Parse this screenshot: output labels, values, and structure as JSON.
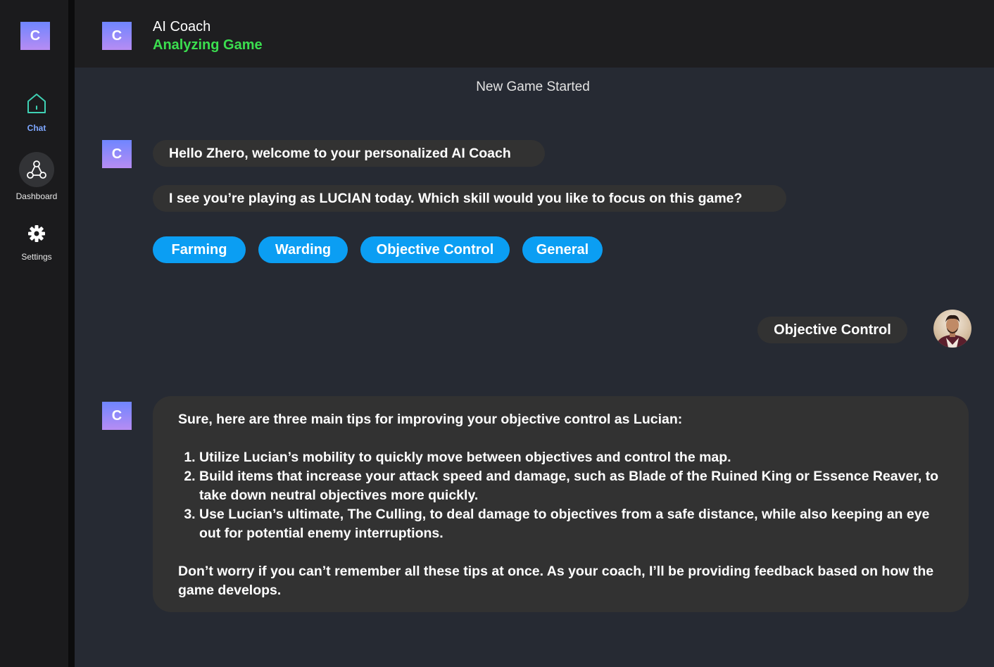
{
  "sidebar": {
    "logo_letter": "C",
    "items": [
      {
        "label": "Chat",
        "icon": "home-icon",
        "active": true
      },
      {
        "label": "Dashboard",
        "icon": "network-icon",
        "active": false
      },
      {
        "label": "Settings",
        "icon": "gear-icon",
        "active": false
      }
    ]
  },
  "header": {
    "avatar_letter": "C",
    "title": "AI Coach",
    "status": "Analyzing Game",
    "status_color": "#3bde4f"
  },
  "chat": {
    "system_notice": "New Game Started",
    "coach_avatar_letter": "C",
    "messages": [
      {
        "from": "coach",
        "text": "Hello Zhero, welcome to your personalized AI Coach"
      },
      {
        "from": "coach",
        "text": "I see you’re playing as LUCIAN today. Which skill would you like to focus on this game?"
      }
    ],
    "options": [
      "Farming",
      "Warding",
      "Objective Control",
      "General"
    ],
    "user_reply": "Objective Control",
    "answer": {
      "intro": "Sure, here are three main tips for improving your objective control as Lucian:",
      "tips": [
        "Utilize Lucian’s mobility to quickly move between objectives and control the map.",
        "Build items that increase your attack speed and damage, such as Blade of the Ruined King or Essence Reaver, to take down neutral objectives more quickly.",
        "Use Lucian’s ultimate, The Culling, to deal damage to objectives from a safe distance, while also keeping an eye out for potential enemy interruptions."
      ],
      "outro": "Don’t worry if you can’t remember all these tips at once. As your coach, I’ll be providing feedback based on how the game develops."
    }
  },
  "colors": {
    "accent_blue": "#0b9ef3",
    "active_nav": "#7ea7ff",
    "bubble_bg": "#323232",
    "main_bg": "#262a33"
  }
}
